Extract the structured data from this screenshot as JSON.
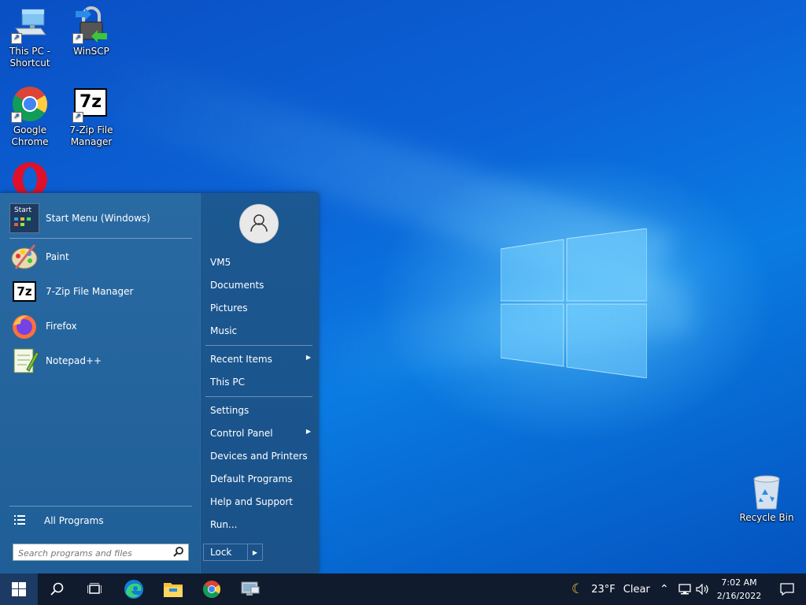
{
  "desktop": {
    "icons": [
      {
        "label_line1": "This PC -",
        "label_line2": "Shortcut",
        "icon": "computer-icon"
      },
      {
        "label_line1": "WinSCP",
        "label_line2": "",
        "icon": "winscp-icon"
      },
      {
        "label_line1": "Google",
        "label_line2": "Chrome",
        "icon": "chrome-icon"
      },
      {
        "label_line1": "7-Zip File",
        "label_line2": "Manager",
        "icon": "7zip-icon"
      },
      {
        "label_line1": "Recycle Bin",
        "label_line2": "",
        "icon": "recycle-bin-icon"
      }
    ],
    "sevenzip_badge": "7z"
  },
  "start_menu": {
    "pinned": [
      {
        "label": "Start Menu (Windows)",
        "icon": "start-menu-settings-icon",
        "badge": "Start"
      },
      {
        "label": "Paint",
        "icon": "paint-icon"
      },
      {
        "label": "7-Zip File Manager",
        "icon": "7zip-icon"
      },
      {
        "label": "Firefox",
        "icon": "firefox-icon"
      },
      {
        "label": "Notepad++",
        "icon": "notepadpp-icon"
      }
    ],
    "all_programs": "All Programs",
    "search_placeholder": "Search programs and files",
    "right_items": [
      {
        "label": "VM5"
      },
      {
        "label": "Documents"
      },
      {
        "label": "Pictures"
      },
      {
        "label": "Music"
      },
      {
        "label": "Recent Items",
        "submenu": true
      },
      {
        "label": "This PC"
      },
      {
        "label": "Settings"
      },
      {
        "label": "Control Panel",
        "submenu": true
      },
      {
        "label": "Devices and Printers"
      },
      {
        "label": "Default Programs"
      },
      {
        "label": "Help and Support"
      },
      {
        "label": "Run..."
      }
    ],
    "lock_label": "Lock"
  },
  "taskbar": {
    "apps": [
      "search-icon",
      "task-view-icon",
      "edge-icon",
      "file-explorer-icon",
      "chrome-icon",
      "remote-desktop-icon"
    ],
    "weather": {
      "temp": "23°F",
      "condition": "Clear"
    },
    "clock": {
      "time": "7:02 AM",
      "date": "2/16/2022"
    }
  },
  "colors": {
    "accent": "#1f5f99",
    "taskbar": "#101b2e",
    "desktop": "#0b63d6"
  }
}
